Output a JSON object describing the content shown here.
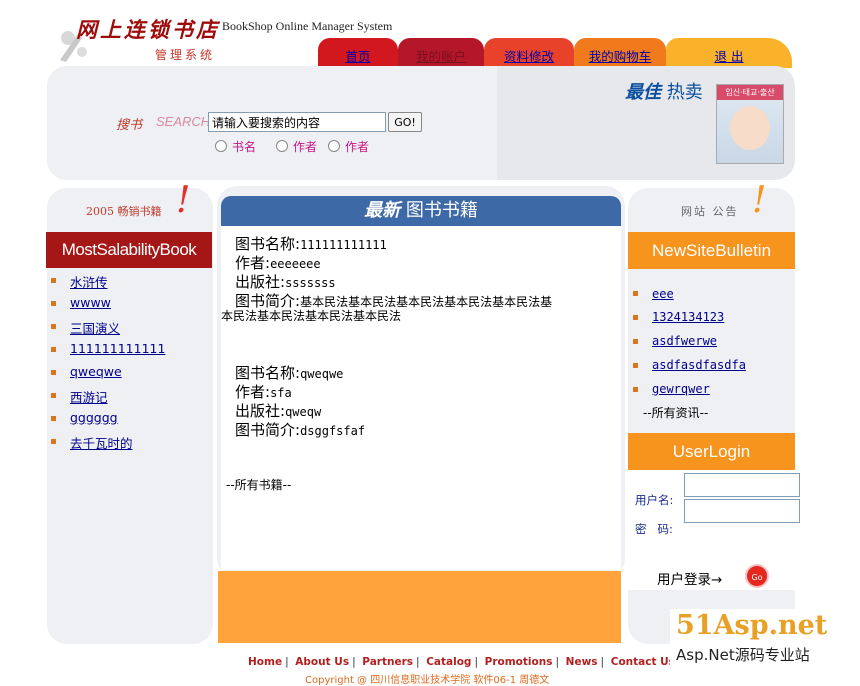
{
  "header": {
    "logo_title": "网上连锁书店",
    "logo_subtitle": "管理系统",
    "logo_english": "BookShop Online Manager System"
  },
  "nav": {
    "tabs": [
      {
        "label": "首页"
      },
      {
        "label": "我的账户"
      },
      {
        "label": "资料修改"
      },
      {
        "label": "我的购物车"
      },
      {
        "label": "退 出"
      }
    ]
  },
  "search": {
    "label_cn": "搜书",
    "label_en": "SEARCH",
    "input_value": "请输入要搜索的内容",
    "button_label": "GO!",
    "options": [
      "书名",
      "作者",
      "作者"
    ]
  },
  "hot": {
    "title_bold": "最佳",
    "title_rest": "热卖",
    "cover_text": "임신·태교·출산"
  },
  "left_panel": {
    "heading": "2005 畅销书籍",
    "banner": "MostSalabilityBook",
    "items": [
      "水浒传",
      "wwww",
      "三国演义",
      "111111111111",
      "qweqwe",
      "西游记",
      "gggggg",
      "去千瓦时的"
    ]
  },
  "center": {
    "heading_bold": "最新",
    "heading_rest": "图书书籍",
    "books": [
      {
        "name_label": "图书名称:",
        "name": "111111111111",
        "author_label": "作者:",
        "author": "eeeeeee",
        "publisher_label": "出版社:",
        "publisher": "sssssss",
        "intro_label": "图书简介:",
        "intro_line1": "基本民法基本民法基本民法基本民法基本民法基",
        "intro_line2": "本民法基本民法基本民法基本民法"
      },
      {
        "name_label": "图书名称:",
        "name": "qweqwe",
        "author_label": "作者:",
        "author": "sfa",
        "publisher_label": "出版社:",
        "publisher": "qweqw",
        "intro_label": "图书简介:",
        "intro_line1": "dsggfsfaf",
        "intro_line2": ""
      }
    ],
    "all_books_link": "--所有书籍--"
  },
  "right_panel": {
    "heading": "网站 公告",
    "bulletin_banner": "NewSiteBulletin",
    "bulletins": [
      "eee",
      "1324134123",
      "asdfwerwe",
      "asdfasdfasdfa",
      "gewrqwer"
    ],
    "all_news_link": "--所有资讯--",
    "login_banner": "UserLogin",
    "username_label": "用户名:",
    "password_label": "密   码:",
    "login_label": "用户登录→",
    "go_label": "Go"
  },
  "footer": {
    "links": [
      "Home",
      "About Us",
      "Partners",
      "Catalog",
      "Promotions",
      "News",
      "Contact Us"
    ],
    "copyright": "Copyright @ 四川信息职业技术学院  软件06-1  周德文"
  },
  "watermark": {
    "brand": "51Asp.net",
    "sub": "Asp.Net源码专业站"
  },
  "colors": {
    "tab1": "#d3171e",
    "tab2": "#b4162a",
    "tab3": "#e8432a",
    "tab4": "#f07a1c",
    "tab5": "#f9b22a",
    "center_head": "#3d6aa6",
    "left_banner": "#a51717",
    "right_banner": "#f7941d"
  }
}
